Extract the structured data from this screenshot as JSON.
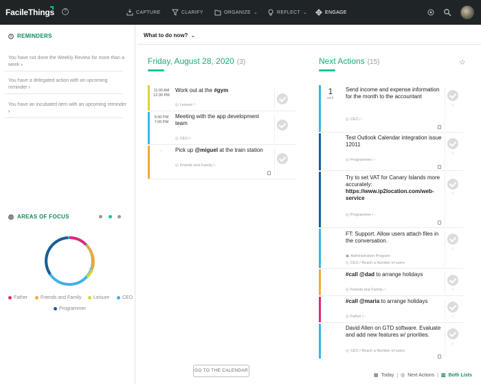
{
  "topbar": {
    "brand": "FacileThings",
    "nav": [
      {
        "label": "CAPTURE",
        "icon": "inbox-icon"
      },
      {
        "label": "CLARIFY",
        "icon": "funnel-icon"
      },
      {
        "label": "ORGANIZE",
        "icon": "folder-icon"
      },
      {
        "label": "REFLECT",
        "icon": "bulb-icon"
      },
      {
        "label": "ENGAGE",
        "icon": "target-icon"
      }
    ]
  },
  "reminders": {
    "title": "REMINDERS",
    "items": [
      "You have not done the Weekly Review for more than a week",
      "You have a delegated action with an upcoming reminder",
      "You have an incubated item with an upcoming reminder"
    ]
  },
  "areas": {
    "title": "AREAS OF FOCUS",
    "legend": [
      {
        "name": "Father",
        "color": "#e0267a"
      },
      {
        "name": "Friends and Family",
        "color": "#f0a93a"
      },
      {
        "name": "Leisure",
        "color": "#d8d633"
      },
      {
        "name": "CEO",
        "color": "#3bb4e5"
      },
      {
        "name": "Programmer",
        "color": "#1a5d96"
      }
    ]
  },
  "main": {
    "what_to_do": "What to do now?",
    "date_title": "Friday, August 28, 2020",
    "date_count": "(3)",
    "next_title": "Next Actions",
    "next_count": "(15)",
    "calendar_button": "GO TO THE CALENDAR"
  },
  "day_tasks": [
    {
      "time1": "11:00 AM",
      "time2": "12:30 PM",
      "pre": "Work out at the ",
      "bold": "#gym",
      "post": "",
      "meta": "Leisure / -",
      "color": "#d8d633"
    },
    {
      "time1": "5:00 PM",
      "time2": "7:00 PM",
      "pre": "Meeting with the app development team",
      "bold": "",
      "post": "",
      "meta": "CEO / -",
      "color": "#3bb4e5"
    },
    {
      "time1": "-",
      "time2": "",
      "pre": "Pick up ",
      "bold": "@miguel",
      "post": " at the train station",
      "meta": "Friends and Family / -",
      "color": "#f0a93a"
    }
  ],
  "next_actions": [
    {
      "day": "1",
      "month": "SEP",
      "pre": "Send income and expense information for the month to the accountant",
      "bold": "",
      "post": "",
      "bold2": "",
      "meta": "CEO / -",
      "meta2": "",
      "color": "#3bb4e5"
    },
    {
      "pre": "Test Outlook Calendar integration issue 12011",
      "bold": "",
      "post": "",
      "bold2": "",
      "meta": "Programmer / -",
      "meta2": "",
      "color": "#1a5d96"
    },
    {
      "pre": "Try to set VAT for Canary Islands more accurately: ",
      "bold": "",
      "post": "",
      "bold2": "https://www.ip2location.com/web-service",
      "meta": "Programmer / -",
      "meta2": "",
      "color": "#1a5d96"
    },
    {
      "pre": "FT: Support. Allow users attach files in the conversation.",
      "bold": "",
      "post": "",
      "bold2": "",
      "meta": "Administration Program",
      "meta2": "CEO / Reach a Number of users",
      "color": "#3bb4e5"
    },
    {
      "pre": "",
      "bold": "#call @dad",
      "post": " to arrange holidays",
      "bold2": "",
      "meta": "Friends and Family / -",
      "meta2": "",
      "color": "#f0a93a"
    },
    {
      "pre": "",
      "bold": "#call @maria",
      "post": " to arrange holidays",
      "bold2": "",
      "meta": "Father / -",
      "meta2": "",
      "color": "#e0267a"
    },
    {
      "pre": "David Allen on GTD software. Evaluate and add new features w/ priorities.",
      "bold": "",
      "post": "",
      "bold2": "",
      "meta": "CEO / Reach a Number of users",
      "meta2": "",
      "color": "#3bb4e5"
    }
  ],
  "footer": {
    "today": "Today",
    "next_actions": "Next Actions",
    "both_lists": "Both Lists"
  }
}
